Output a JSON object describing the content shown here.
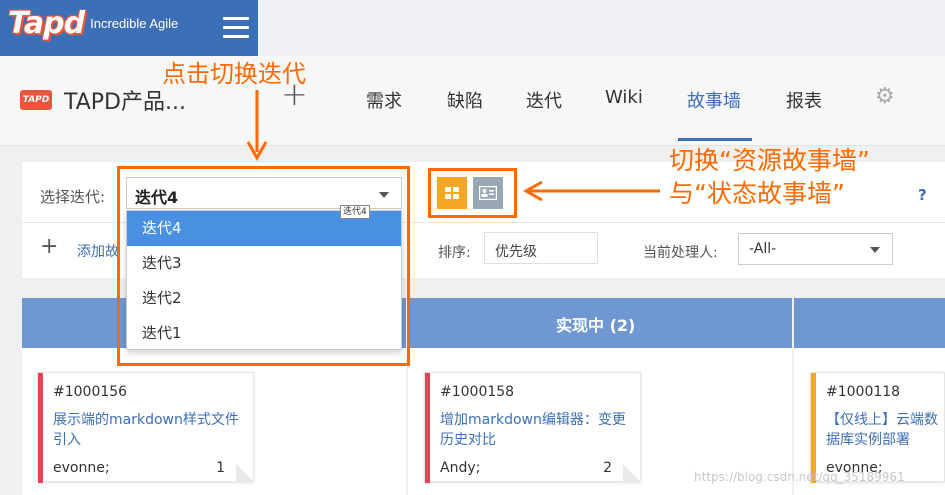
{
  "brand": {
    "logo_text": "Tapd",
    "tagline": "Incredible Agile"
  },
  "project": {
    "icon_text": "TAPD",
    "name": "TAPD产品..."
  },
  "nav": {
    "add_symbol": "+",
    "items": [
      {
        "label": "需求"
      },
      {
        "label": "缺陷"
      },
      {
        "label": "迭代"
      },
      {
        "label": "Wiki"
      },
      {
        "label": "故事墙",
        "active": true
      },
      {
        "label": "报表"
      }
    ]
  },
  "toolbar": {
    "iteration_label": "选择迭代:",
    "iteration_selected": "迭代4",
    "add_symbol": "+",
    "add_label": "添加故",
    "sort_label": "排序:",
    "sort_value": "优先级",
    "owner_label": "当前处理人:",
    "owner_value": "-All-",
    "help": "?"
  },
  "dropdown": {
    "tooltip": "迭代4",
    "options": [
      "迭代4",
      "迭代3",
      "迭代2",
      "迭代1"
    ],
    "selected": "迭代4"
  },
  "board": {
    "column_title": "实现中 (2)",
    "cards": [
      {
        "id": "#1000156",
        "title": "展示端的markdown样式文件引入",
        "owner": "evonne;",
        "points": "1",
        "stripe": "#e9415a"
      },
      {
        "id": "#1000158",
        "title": "增加markdown编辑器：变更历史对比",
        "owner": "Andy;",
        "points": "2",
        "stripe": "#e9415a"
      },
      {
        "id": "#1000118",
        "title": "【仅线上】云端数据库实例部署",
        "owner": "evonne;",
        "points": "",
        "stripe": "#f5a623"
      }
    ]
  },
  "annotations": {
    "switch_iteration": "点击切换迭代",
    "switch_view_line1": "切换“资源故事墙”",
    "switch_view_line2": "与“状态故事墙”"
  },
  "watermark": "https://blog.csdn.net/qq_35189961",
  "colors": {
    "brand_blue": "#3d6fb6",
    "annotation_orange": "#ff6a00",
    "column_header": "#6f97d2"
  }
}
